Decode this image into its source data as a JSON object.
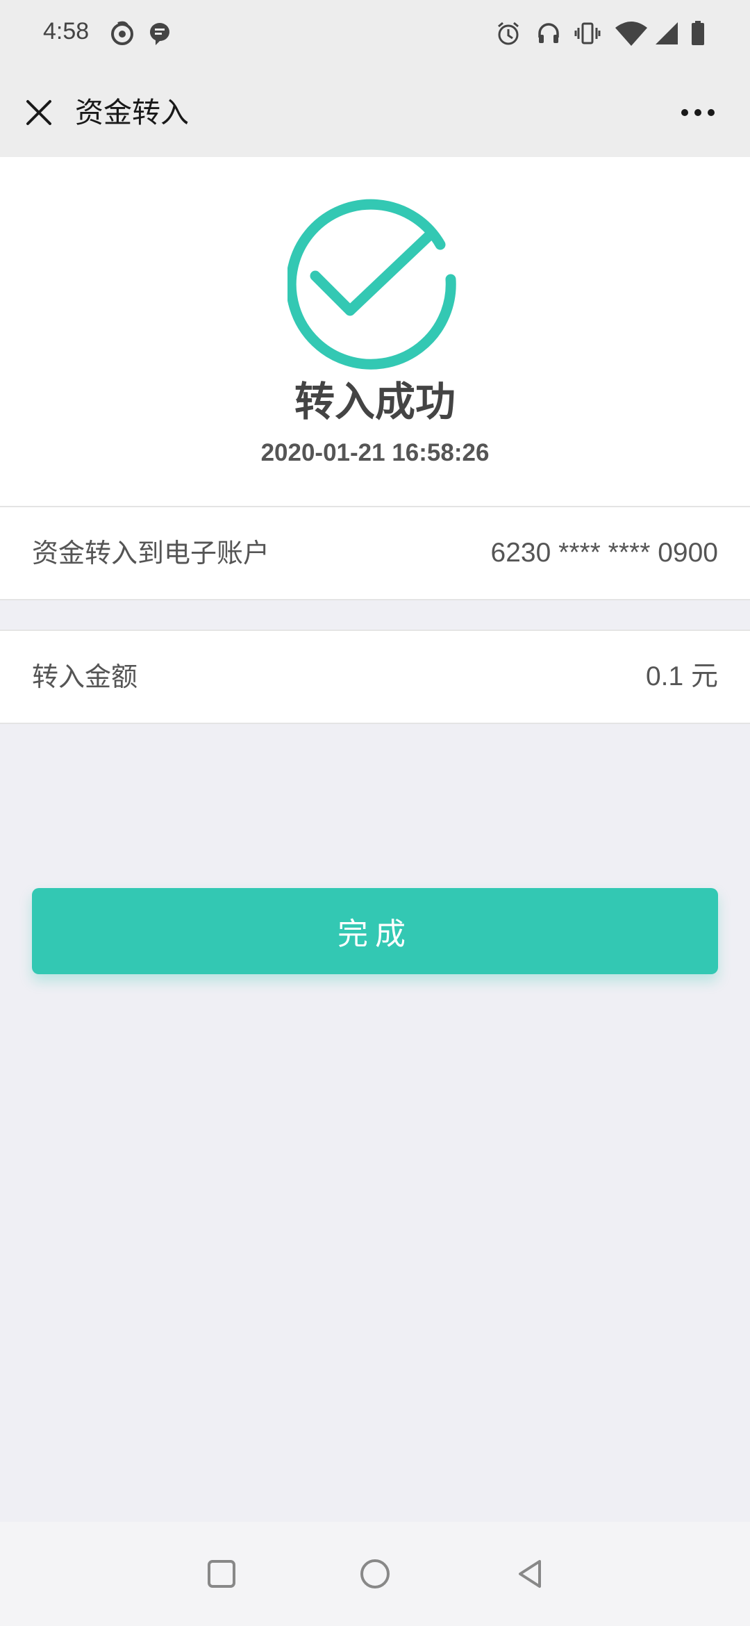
{
  "status_bar": {
    "time": "4:58"
  },
  "nav": {
    "title": "资金转入",
    "close_icon": "close-icon",
    "more_icon": "more-dots-icon"
  },
  "result": {
    "title": "转入成功",
    "timestamp": "2020-01-21 16:58:26",
    "icon": "check-circle-icon"
  },
  "details": {
    "account_label": "资金转入到电子账户",
    "account_value": "6230 **** **** 0900",
    "amount_label": "转入金额",
    "amount_value": "0.1 元"
  },
  "actions": {
    "done_label": "完成"
  },
  "colors": {
    "accent": "#33c8b3",
    "background": "#efeff4",
    "header": "#ededed"
  }
}
